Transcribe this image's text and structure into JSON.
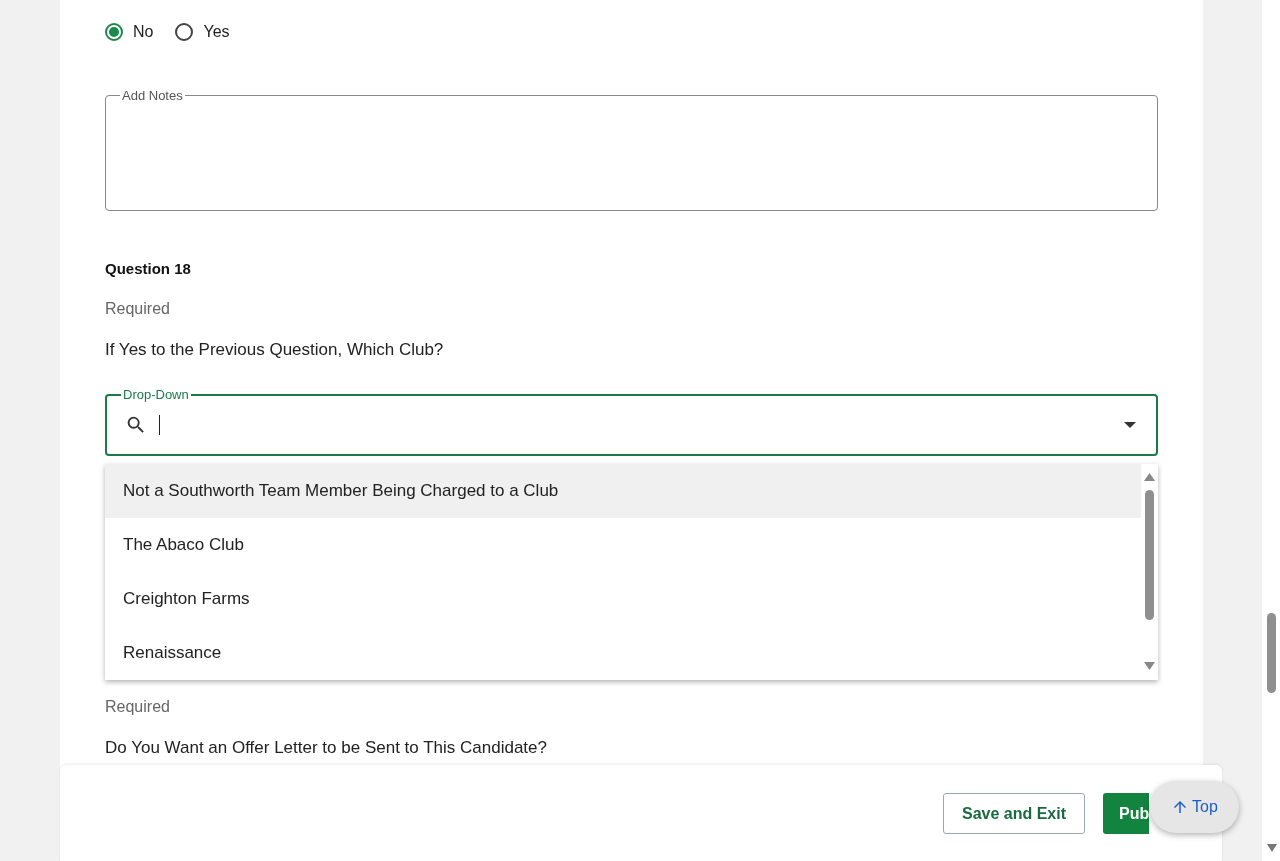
{
  "answer_options": [
    {
      "label": "No",
      "selected": true
    },
    {
      "label": "Yes",
      "selected": false
    }
  ],
  "notes": {
    "label": "Add Notes"
  },
  "question": {
    "number": "Question 18",
    "required": "Required",
    "text": "If Yes to the Previous Question, Which Club?"
  },
  "dropdown": {
    "label": "Drop-Down",
    "expanded": true,
    "options": [
      {
        "label": "Not a Southworth Team Member Being Charged to a Club",
        "selected": true
      },
      {
        "label": "The Abaco Club",
        "selected": false
      },
      {
        "label": "Creighton Farms",
        "selected": false
      },
      {
        "label": "Renaissance",
        "selected": false
      }
    ]
  },
  "next_question": {
    "required": "Required",
    "text": "Do You Want an Offer Letter to be Sent to This Candidate?"
  },
  "footer": {
    "buttons": [
      {
        "label": "Save and Exit",
        "kind": "outline"
      },
      {
        "label": "Pub",
        "kind": "primary"
      }
    ]
  },
  "top_button": {
    "label": "Top"
  }
}
